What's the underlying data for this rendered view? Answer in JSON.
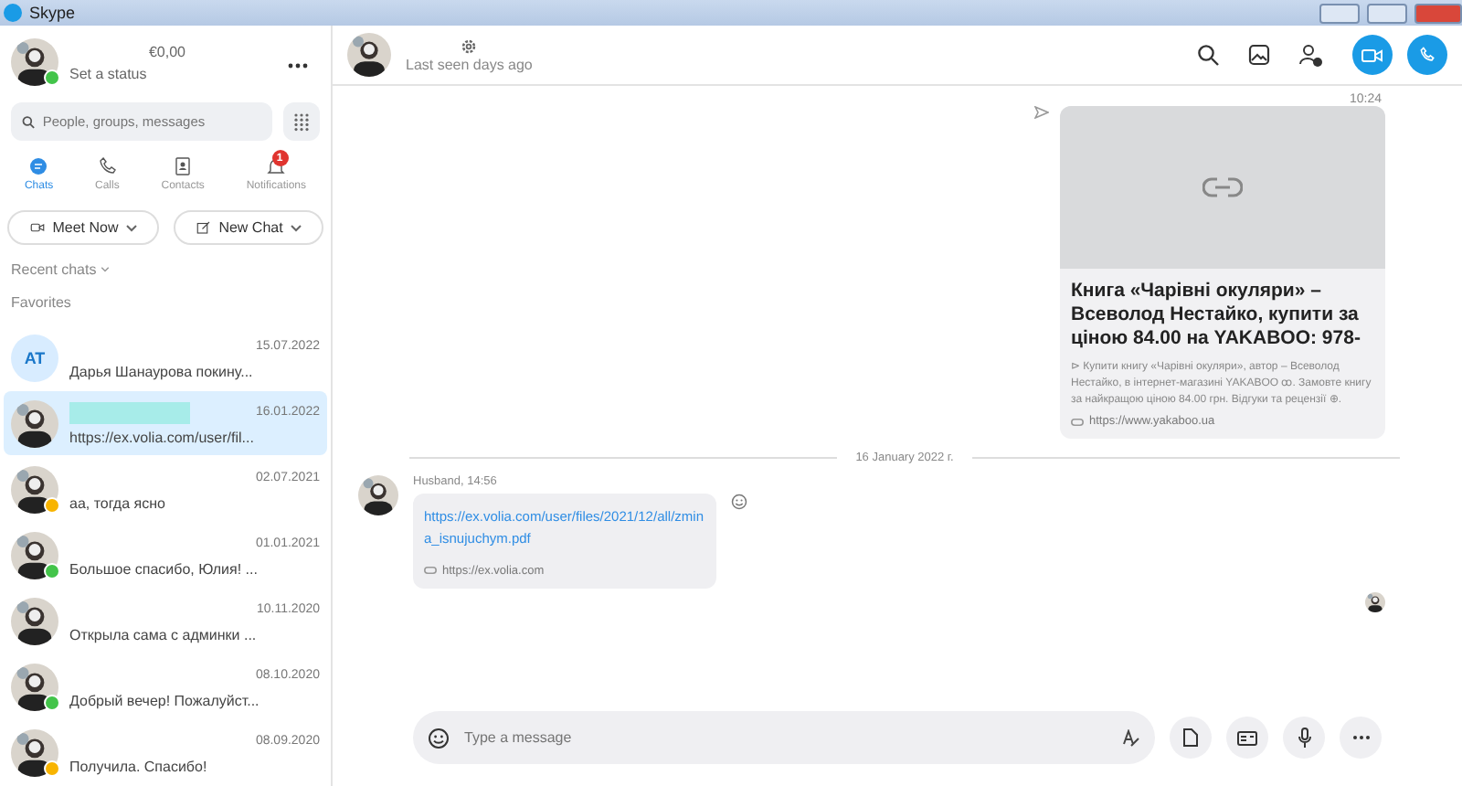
{
  "window": {
    "title": "Skype"
  },
  "profile": {
    "balance": "€0,00",
    "status_text": "Set a status",
    "color": "#43c44a"
  },
  "search": {
    "placeholder": "People, groups, messages"
  },
  "nav": [
    {
      "label": "Chats",
      "selected": true
    },
    {
      "label": "Calls",
      "selected": false
    },
    {
      "label": "Contacts",
      "selected": false
    },
    {
      "label": "Notifications",
      "selected": false,
      "badge": "1"
    }
  ],
  "actions": [
    {
      "label": "Meet Now"
    },
    {
      "label": "New Chat"
    }
  ],
  "recent_label": "Recent chats",
  "favorites_label": "Favorites",
  "chats": [
    {
      "kind": "initials",
      "initials": "AT",
      "preview": "Дарья Шанаурова покину...",
      "date": "15.07.2022",
      "selected": false
    },
    {
      "kind": "picture",
      "redacted": true,
      "preview": "https://ex.volia.com/user/fil...",
      "date": "16.01.2022",
      "selected": true
    },
    {
      "kind": "picture",
      "preview": "аа, тогда ясно",
      "date": "02.07.2021",
      "selected": false,
      "color": "#f8b400"
    },
    {
      "kind": "picture",
      "preview": "Большое спасибо, Юлия! ...",
      "date": "01.01.2021",
      "selected": false,
      "color": "#43c44a"
    },
    {
      "kind": "picture",
      "preview": "Открыла сама с админки ...",
      "date": "10.11.2020",
      "selected": false
    },
    {
      "kind": "picture",
      "preview": "Добрый вечер! Пожалуйст...",
      "date": "08.10.2020",
      "selected": false,
      "color": "#43c44a"
    },
    {
      "kind": "picture",
      "preview": "Получила. Спасибо!",
      "date": "08.09.2020",
      "selected": false,
      "color": "#f8b400"
    }
  ],
  "header": {
    "last_seen": "Last seen days ago"
  },
  "messages": [
    {
      "kind": "link_card",
      "time": "10:24",
      "title": "Книга «Чарівні окуляри» – Всеволод Нестайко, купити за ціною 84.00 на YAKABOO: 978-",
      "description": "⊳ Купити книгу «Чарівні окуляри», автор – Всеволод Нестайко, в інтернет-магазині YAKABOO ꝏ. Замовте книгу за найкращою ціною 84.00 грн. Відгуки та рецензії ⊕.",
      "domain": "https://www.yakaboo.ua"
    },
    {
      "kind": "date_divider",
      "text": "16 January 2022 г."
    },
    {
      "kind": "incoming",
      "sender": "Husband, 14:56",
      "link": "https://ex.volia.com/user/files/2021/12/all/zmina_isnujuchym.pdf",
      "domain": "https://ex.volia.com"
    }
  ],
  "composer": {
    "placeholder": "Type a message"
  }
}
